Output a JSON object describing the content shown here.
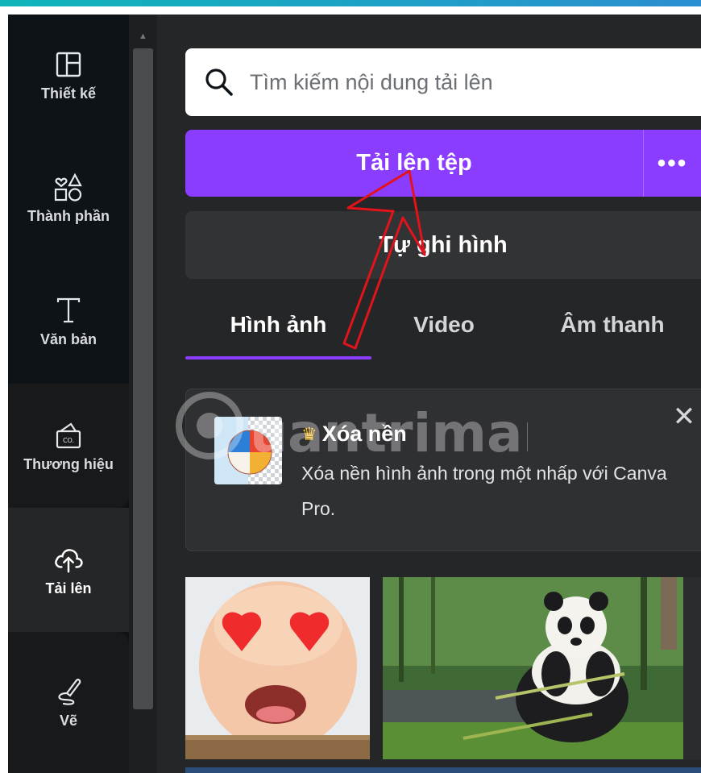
{
  "sidebar": {
    "items": [
      {
        "label": "Thiết kế",
        "icon": "layout-icon"
      },
      {
        "label": "Thành phần",
        "icon": "elements-icon"
      },
      {
        "label": "Văn bản",
        "icon": "text-icon"
      },
      {
        "label": "Thương hiệu",
        "icon": "brand-kit-icon"
      },
      {
        "label": "Tải lên",
        "icon": "cloud-upload-icon",
        "active": true
      },
      {
        "label": "Vẽ",
        "icon": "draw-pen-icon"
      }
    ]
  },
  "search": {
    "placeholder": "Tìm kiếm nội dung tải lên",
    "icon": "search-icon"
  },
  "upload_button": {
    "label": "Tải lên tệp",
    "more_label": "•••"
  },
  "record_button": {
    "label": "Tự ghi hình"
  },
  "tabs": [
    {
      "label": "Hình ảnh",
      "active": true
    },
    {
      "label": "Video"
    },
    {
      "label": "Âm thanh"
    }
  ],
  "promo": {
    "title": "Xóa nền",
    "description": "Xóa nền hình ảnh trong một nhấp với Canva Pro.",
    "close": "✕"
  },
  "watermark": {
    "text": "uantrimang"
  },
  "gallery": [
    {
      "name": "baby-heart-eyes-photo"
    },
    {
      "name": "panda-eating-bamboo-photo"
    }
  ],
  "colors": {
    "accent": "#8b3dff",
    "panel": "#252627",
    "sidebar": "#0e1318",
    "annotation_arrow": "#e2131b"
  }
}
